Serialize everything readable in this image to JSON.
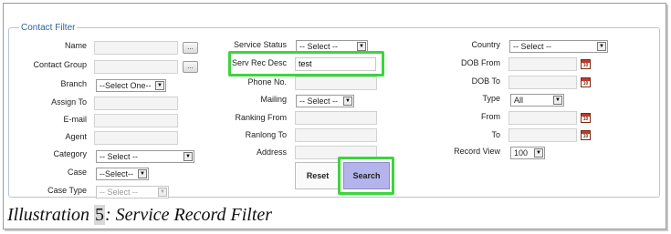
{
  "legend": "Contact Filter",
  "col1": {
    "name_label": "Name",
    "contact_group_label": "Contact Group",
    "branch_label": "Branch",
    "branch_value": "--Select One--",
    "assign_to_label": "Assign To",
    "email_label": "E-mail",
    "agent_label": "Agent",
    "category_label": "Category",
    "category_value": "-- Select --",
    "case_label": "Case",
    "case_value": "--Select--",
    "case_type_label": "Case Type",
    "case_type_value": "-- Select --",
    "lookup_label": "..."
  },
  "col2": {
    "service_status_label": "Service Status",
    "service_status_value": "-- Select --",
    "serv_rec_desc_label": "Serv Rec Desc",
    "serv_rec_desc_value": "test",
    "phone_label": "Phone No.",
    "mailing_label": "Mailing",
    "mailing_value": "-- Select --",
    "ranking_from_label": "Ranking From",
    "ranking_to_label": "Ranlong To",
    "address_label": "Address",
    "reset_label": "Reset",
    "search_label": "Search"
  },
  "col3": {
    "country_label": "Country",
    "country_value": "-- Select --",
    "dob_from_label": "DOB From",
    "dob_to_label": "DOB To",
    "type_label": "Type",
    "type_value": "All",
    "from_label": "From",
    "to_label": "To",
    "record_view_label": "Record View",
    "record_view_value": "100",
    "calendar_glyph": "10"
  },
  "caption": {
    "prefix": "Illustration ",
    "number": "5",
    "suffix": ": Service Record Filter"
  },
  "highlight_color": "#3dd43d",
  "search_button_color": "#b4b4ec"
}
